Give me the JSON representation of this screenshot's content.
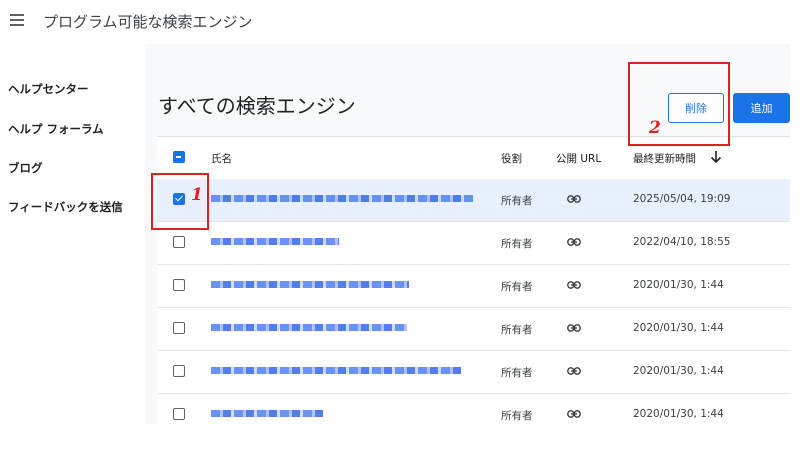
{
  "app": {
    "title": "プログラム可能な検索エンジン"
  },
  "sidebar": {
    "items": [
      {
        "label": "ヘルプセンター"
      },
      {
        "label": "ヘルプ フォーラム"
      },
      {
        "label": "ブログ"
      },
      {
        "label": "フィードバックを送信"
      }
    ]
  },
  "main": {
    "title": "すべての検索エンジン",
    "delete_label": "削除",
    "add_label": "追加"
  },
  "table": {
    "headers": {
      "name": "氏名",
      "role": "役割",
      "public_url": "公開 URL",
      "last_updated": "最終更新時間",
      "sort_icon": "arrow-down-icon"
    },
    "rows": [
      {
        "role": "所有者",
        "updated": "2025/05/04, 19:09",
        "selected": true
      },
      {
        "role": "所有者",
        "updated": "2022/04/10, 18:55",
        "selected": false
      },
      {
        "role": "所有者",
        "updated": "2020/01/30, 1:44",
        "selected": false
      },
      {
        "role": "所有者",
        "updated": "2020/01/30, 1:44",
        "selected": false
      },
      {
        "role": "所有者",
        "updated": "2020/01/30, 1:44",
        "selected": false
      },
      {
        "role": "所有者",
        "updated": "2020/01/30, 1:44",
        "selected": false
      }
    ]
  },
  "annotations": {
    "one": "1",
    "two": "2"
  },
  "colors": {
    "accent": "#1a73e8",
    "annotation": "#e02020",
    "selected_row": "#e8f0fe"
  }
}
